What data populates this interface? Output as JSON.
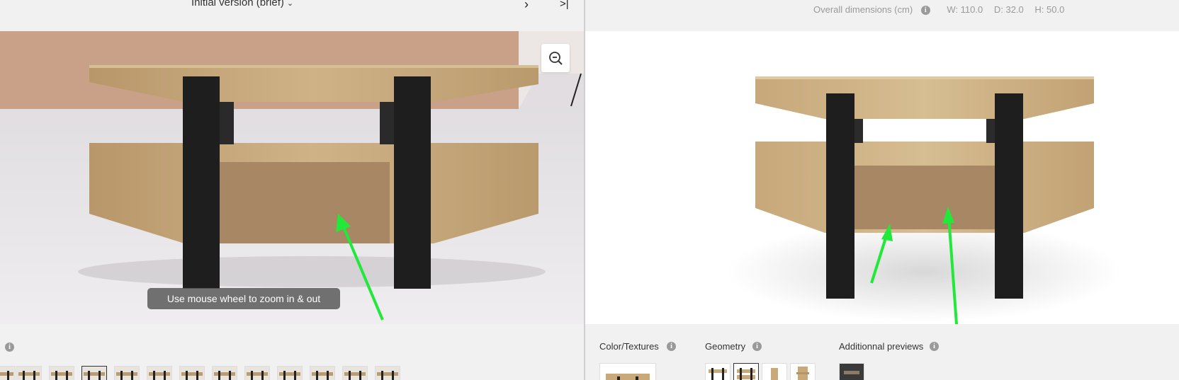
{
  "left_panel": {
    "version_label": "Initial version (brief)",
    "next_label": "›",
    "last_label": ">|",
    "zoom_hint": "Use mouse wheel to zoom in & out",
    "thumbnail_count": 13,
    "selected_thumbnail": 3
  },
  "right_panel": {
    "dimensions_label": "Overall dimensions (cm)",
    "width": "W: 110.0",
    "depth": "D: 32.0",
    "height": "H: 50.0",
    "sections": {
      "color_textures": "Color/Textures",
      "geometry": "Geometry",
      "additional_previews": "Additionnal previews"
    }
  },
  "colors": {
    "wood": "#c9a97a",
    "leg": "#1e1e1e",
    "panel_back": "#a88764",
    "annotation_arrow": "#22e83a"
  }
}
